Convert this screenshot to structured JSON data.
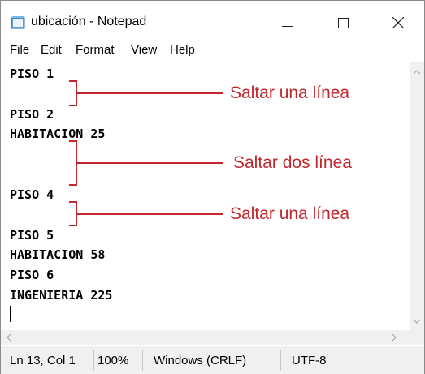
{
  "window": {
    "title": "ubicación - Notepad"
  },
  "menu": [
    "File",
    "Edit",
    "Format",
    "View",
    "Help"
  ],
  "editor": {
    "lines": [
      "PISO 1",
      "",
      "PISO 2",
      "HABITACION 25",
      "",
      "",
      "PISO 4",
      "",
      "PISO 5",
      "HABITACION 58",
      "PISO 6",
      "INGENIERIA 225",
      ""
    ]
  },
  "annotations": [
    "Saltar una línea",
    "Saltar dos línea",
    "Saltar una línea"
  ],
  "annotation_color": "#c4272d",
  "statusbar": {
    "position": "Ln 13, Col 1",
    "zoom": "100%",
    "line_ending": "Windows (CRLF)",
    "encoding": "UTF-8"
  },
  "icons": [
    "notepad-icon",
    "minimize-icon",
    "maximize-icon",
    "close-icon",
    "scroll-up-icon",
    "scroll-down-icon",
    "scroll-left-icon",
    "scroll-right-icon"
  ]
}
